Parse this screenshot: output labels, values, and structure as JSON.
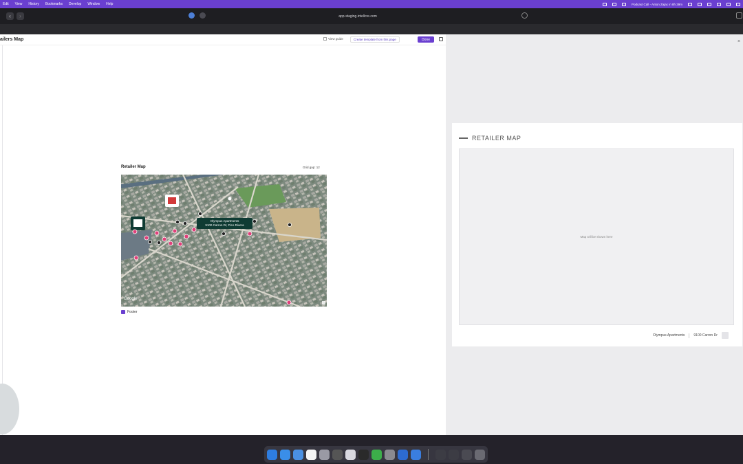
{
  "menubar": {
    "items": [
      "Edit",
      "View",
      "History",
      "Bookmarks",
      "Develop",
      "Window",
      "Help"
    ],
    "status_text": "Podcast Call - Anton Zajac in 8h 39m"
  },
  "browser": {
    "url": "app-staging.intellcre.com"
  },
  "page": {
    "title": "ailers Map",
    "view_guide": "View guide",
    "create_template": "Create template from this page",
    "done": "Done"
  },
  "widget": {
    "title": "Retailer Map",
    "grid_gap": "Grid gap: 12",
    "map_label_line1": "Olympus Apartments",
    "map_label_line2": "9100 Carron Dr, Pico Rivera",
    "map_credit": "Google",
    "footer_label": "Footer"
  },
  "preview": {
    "heading": "RETAILER MAP",
    "placeholder": "Map will be shown here",
    "property_name": "Olympus Apartments",
    "property_address": "9100 Carron Dr"
  },
  "colors": {
    "accent": "#6a3fd0",
    "marker_pink": "#e0407a",
    "label_bg": "#0f3b33"
  }
}
